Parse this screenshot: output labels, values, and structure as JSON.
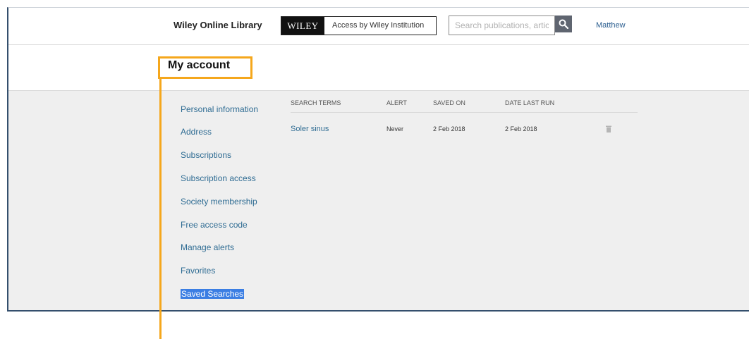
{
  "header": {
    "library_link": "Wiley Online Library",
    "logo_text": "WILEY",
    "access_text": "Access by Wiley Institution",
    "search_placeholder": "Search publications, articles",
    "user_name": "Matthew"
  },
  "page": {
    "title": "My account"
  },
  "sidebar": {
    "items": [
      {
        "label": "Personal information",
        "active": false
      },
      {
        "label": "Address",
        "active": false
      },
      {
        "label": "Subscriptions",
        "active": false
      },
      {
        "label": "Subscription access",
        "active": false
      },
      {
        "label": "Society membership",
        "active": false
      },
      {
        "label": "Free access code",
        "active": false
      },
      {
        "label": "Manage alerts",
        "active": false
      },
      {
        "label": "Favorites",
        "active": false
      },
      {
        "label": "Saved Searches",
        "active": true
      }
    ]
  },
  "saved_searches": {
    "columns": [
      "SEARCH TERMS",
      "ALERT",
      "SAVED ON",
      "DATE LAST RUN"
    ],
    "rows": [
      {
        "term": "Soler sinus",
        "alert": "Never",
        "saved_on": "2 Feb 2018",
        "last_run": "2 Feb 2018"
      }
    ]
  },
  "colors": {
    "link": "#2f6c93",
    "active_highlight": "#3b7ee3",
    "annotation": "#f5a71c",
    "content_bg": "#efefef"
  },
  "icons": {
    "search": "magnifier-icon",
    "delete": "trash-icon"
  }
}
